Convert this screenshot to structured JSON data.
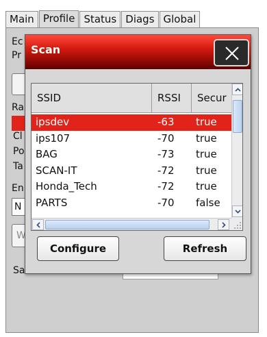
{
  "tabs": [
    {
      "label": "Main"
    },
    {
      "label": "Profile"
    },
    {
      "label": "Status"
    },
    {
      "label": "Diags"
    },
    {
      "label": "Global"
    }
  ],
  "background_fragments": [
    "Ec",
    "Pr",
    "Ra",
    "Cl",
    "Po",
    "Ta",
    "En",
    "N",
    "W",
    "Sa"
  ],
  "dialog": {
    "title": "Scan",
    "close_glyph": "close-icon",
    "columns": [
      "SSID",
      "RSSI",
      "Secur"
    ],
    "networks": [
      {
        "ssid": "ipsdev",
        "rssi": "-63",
        "secure": "true",
        "selected": true
      },
      {
        "ssid": "ips107",
        "rssi": "-70",
        "secure": "true",
        "selected": false
      },
      {
        "ssid": "BAG",
        "rssi": "-73",
        "secure": "true",
        "selected": false
      },
      {
        "ssid": "SCAN-IT",
        "rssi": "-72",
        "secure": "true",
        "selected": false
      },
      {
        "ssid": "Honda_Tech",
        "rssi": "-72",
        "secure": "true",
        "selected": false
      },
      {
        "ssid": "PARTS",
        "rssi": "-70",
        "secure": "false",
        "selected": false
      }
    ],
    "configure_label": "Configure",
    "refresh_label": "Refresh"
  },
  "colors": {
    "selection": "#e2231a",
    "titlebar": "#c0130b"
  }
}
